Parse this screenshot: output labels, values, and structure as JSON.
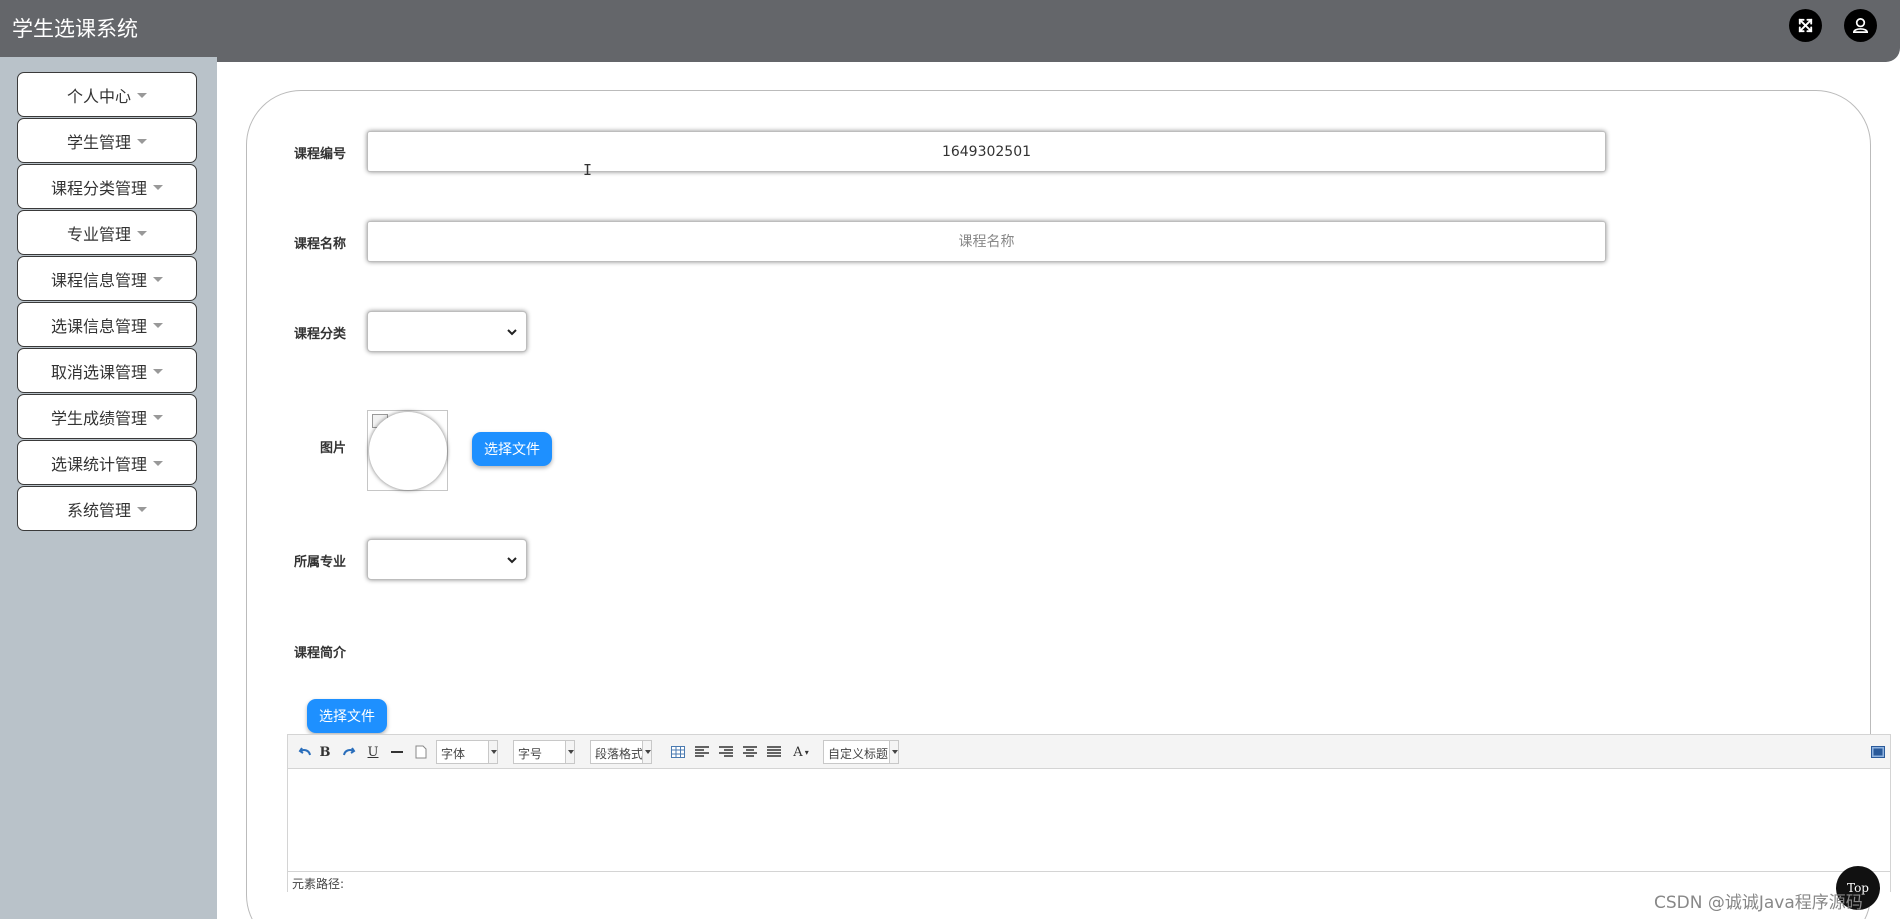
{
  "header": {
    "title": "学生选课系统",
    "fullscreen_icon": "fullscreen-icon",
    "user_icon": "user-icon",
    "bg_color": "#64666a"
  },
  "sidebar": {
    "bg_color": "#b9c2c9",
    "items": [
      {
        "label": "个人中心"
      },
      {
        "label": "学生管理"
      },
      {
        "label": "课程分类管理"
      },
      {
        "label": "专业管理"
      },
      {
        "label": "课程信息管理"
      },
      {
        "label": "选课信息管理"
      },
      {
        "label": "取消选课管理"
      },
      {
        "label": "学生成绩管理"
      },
      {
        "label": "选课统计管理"
      },
      {
        "label": "系统管理"
      }
    ]
  },
  "form": {
    "course_no": {
      "label": "课程编号",
      "value": "1649302501"
    },
    "course_name": {
      "label": "课程名称",
      "value": "",
      "placeholder": "课程名称"
    },
    "category": {
      "label": "课程分类",
      "value": ""
    },
    "image": {
      "label": "图片",
      "button": "选择文件"
    },
    "major": {
      "label": "所属专业",
      "value": ""
    },
    "intro": {
      "label": "课程简介",
      "button": "选择文件"
    }
  },
  "editor": {
    "font_family": "字体",
    "font_size": "字号",
    "paragraph": "段落格式",
    "custom_title": "自定义标题",
    "element_path_label": "元素路径:",
    "tools": [
      "undo-icon",
      "bold-icon",
      "redo-icon",
      "underline-icon",
      "horizontal-rule-icon",
      "new-page-icon",
      "table-icon",
      "align-left-icon",
      "align-right-icon",
      "align-center-icon",
      "justify-icon",
      "font-color-icon",
      "fullscreen-icon"
    ]
  },
  "top_button": "Top",
  "watermark": "CSDN @诚诚Java程序源码",
  "accent_color": "#1e90ff"
}
